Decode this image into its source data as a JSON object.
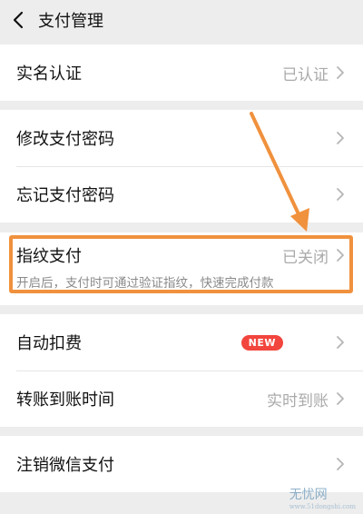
{
  "header": {
    "title": "支付管理"
  },
  "rows": {
    "realname": {
      "label": "实名认证",
      "value": "已认证"
    },
    "change_pwd": {
      "label": "修改支付密码"
    },
    "forgot_pwd": {
      "label": "忘记支付密码"
    },
    "fingerprint": {
      "label": "指纹支付",
      "value": "已关闭",
      "description": "开启后，支付时可通过验证指纹，快速完成付款"
    },
    "auto_deduct": {
      "label": "自动扣费",
      "badge": "NEW"
    },
    "transfer_time": {
      "label": "转账到账时间",
      "value": "实时到账"
    },
    "deregister": {
      "label": "注销微信支付"
    }
  },
  "watermark": {
    "text": "无忧网",
    "url": "www.51dongshi.com"
  },
  "colors": {
    "highlight": "#f0913d",
    "badge": "#f2453d",
    "background": "#ededed"
  },
  "icons": {
    "back": "chevron-left-icon",
    "row_arrow": "chevron-right-icon"
  }
}
